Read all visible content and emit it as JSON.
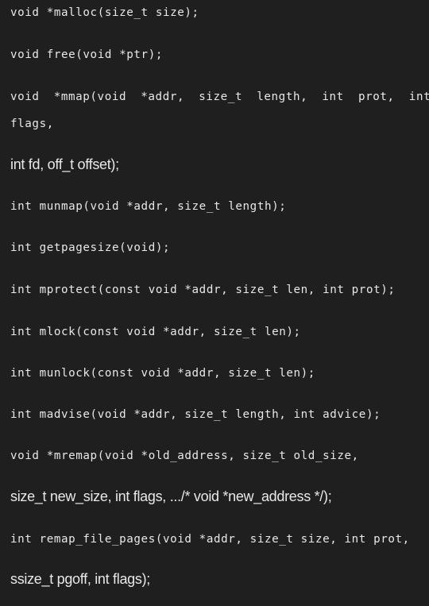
{
  "lines": [
    "void *malloc(size_t size);",
    "void free(void *ptr);",
    "void *mmap(void *addr, size_t length, int prot, int",
    "flags,",
    "int fd, off_t offset);",
    "int munmap(void *addr, size_t length);",
    "int getpagesize(void);",
    "int mprotect(const void *addr, size_t len, int prot);",
    "int mlock(const void *addr, size_t len);",
    "int munlock(const void *addr, size_t len);",
    "int madvise(void *addr, size_t length, int advice);",
    "void *mremap(void *old_address, size_t old_size,",
    "size_t new_size, int flags, .../* void *new_address */);",
    "int remap_file_pages(void *addr, size_t size, int prot,",
    "ssize_t pgoff, int flags);"
  ],
  "colors": {
    "background": "#1f1f1f",
    "text": "#e8e8e8"
  }
}
